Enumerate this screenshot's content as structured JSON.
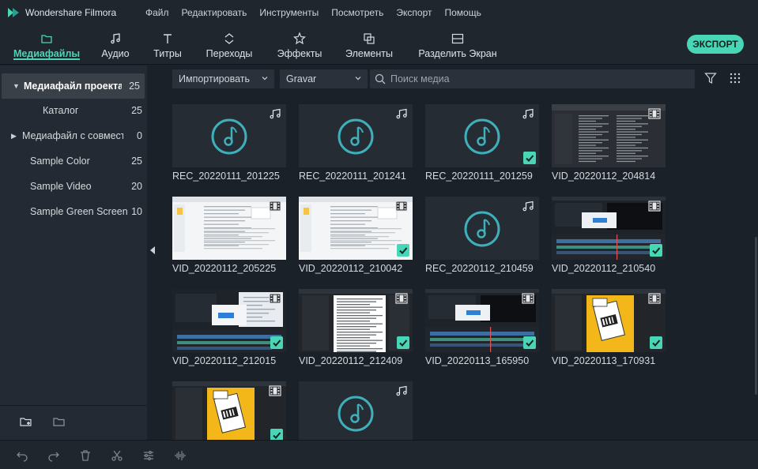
{
  "app": {
    "name": "Wondershare Filmora"
  },
  "menu": [
    "Файл",
    "Редактировать",
    "Инструменты",
    "Посмотреть",
    "Экспорт",
    "Помощь"
  ],
  "toolbar": {
    "tabs": [
      {
        "label": "Медиафайлы",
        "icon": "folder-icon",
        "active": true
      },
      {
        "label": "Аудио",
        "icon": "music-note-icon",
        "active": false
      },
      {
        "label": "Титры",
        "icon": "text-icon",
        "active": false
      },
      {
        "label": "Переходы",
        "icon": "transition-icon",
        "active": false
      },
      {
        "label": "Эффекты",
        "icon": "effects-icon",
        "active": false
      },
      {
        "label": "Элементы",
        "icon": "elements-icon",
        "active": false
      },
      {
        "label": "Разделить Экран",
        "icon": "split-screen-icon",
        "active": false
      }
    ],
    "export_label": "ЭКСПОРТ"
  },
  "sidebar": {
    "items": [
      {
        "name": "Медиафайл проекта",
        "count": "25",
        "expanded": true,
        "selected": true
      },
      {
        "name": "Каталог",
        "count": "25",
        "indent": true
      },
      {
        "name": "Медиафайл с совместного доступа",
        "count": "0",
        "collapsed": true
      },
      {
        "name": "Sample Color",
        "count": "25"
      },
      {
        "name": "Sample Video",
        "count": "20"
      },
      {
        "name": "Sample Green Screen",
        "count": "10"
      }
    ]
  },
  "filters": {
    "import_label": "Импортировать",
    "record_label": "Gravar",
    "search_placeholder": "Поиск медиа"
  },
  "media": [
    {
      "title": "REC_20220111_201225",
      "type": "audio",
      "checked": false
    },
    {
      "title": "REC_20220111_201241",
      "type": "audio",
      "checked": false
    },
    {
      "title": "REC_20220111_201259",
      "type": "audio",
      "checked": true
    },
    {
      "title": "VID_20220112_204814",
      "type": "video",
      "thumb": "dark-doc",
      "checked": false
    },
    {
      "title": "VID_20220112_205225",
      "type": "video",
      "thumb": "light-doc",
      "checked": false
    },
    {
      "title": "VID_20220112_210042",
      "type": "video",
      "thumb": "light-doc",
      "checked": true
    },
    {
      "title": "REC_20220112_210459",
      "type": "audio",
      "checked": false
    },
    {
      "title": "VID_20220112_210540",
      "type": "video",
      "thumb": "editor",
      "checked": true
    },
    {
      "title": "VID_20220112_212015",
      "type": "video",
      "thumb": "editor-dialog",
      "checked": true
    },
    {
      "title": "VID_20220112_212409",
      "type": "video",
      "thumb": "white-page",
      "checked": true
    },
    {
      "title": "VID_20220113_165950",
      "type": "video",
      "thumb": "editor",
      "checked": true
    },
    {
      "title": "VID_20220113_170931",
      "type": "video",
      "thumb": "yellow",
      "checked": true
    },
    {
      "title": "",
      "type": "video",
      "thumb": "yellow",
      "checked": true
    },
    {
      "title": "",
      "type": "audio",
      "checked": false
    }
  ],
  "colors": {
    "accent": "#49d6b6",
    "audio_icon": "#3fb0ba"
  }
}
